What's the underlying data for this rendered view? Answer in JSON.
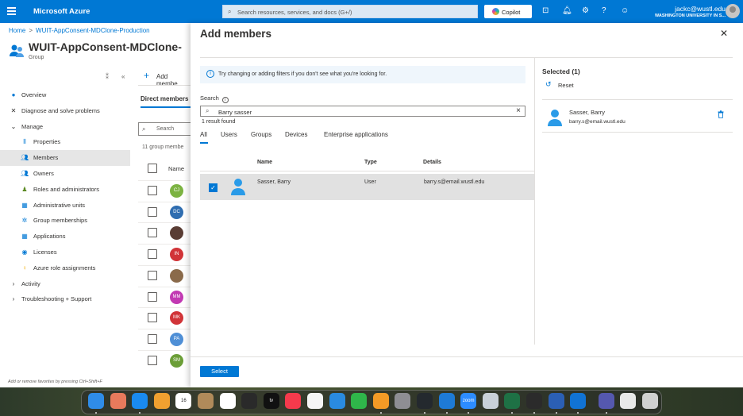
{
  "topbar": {
    "brand": "Microsoft Azure",
    "search_placeholder": "Search resources, services, and docs (G+/)",
    "copilot_label": "Copilot",
    "user_email": "jackc@wustl.edu",
    "user_org": "WASHINGTON UNIVERSITY IN S..."
  },
  "breadcrumb": {
    "home": "Home",
    "current": "WUIT-AppConsent-MDClone-Production"
  },
  "group": {
    "title": "WUIT-AppConsent-MDClone-",
    "subtitle": "Group"
  },
  "nav": [
    {
      "label": "Overview",
      "icon": "info-icon",
      "color": "#0078d4",
      "indent": 0
    },
    {
      "label": "Diagnose and solve problems",
      "icon": "wrench-icon",
      "color": "#323130",
      "indent": 0
    },
    {
      "label": "Manage",
      "icon": "chevron-down-icon",
      "color": "#323130",
      "indent": 0,
      "expander": "⌄"
    },
    {
      "label": "Properties",
      "icon": "properties-icon",
      "color": "#0078d4",
      "indent": 1
    },
    {
      "label": "Members",
      "icon": "members-icon",
      "color": "#0078d4",
      "indent": 1,
      "selected": true
    },
    {
      "label": "Owners",
      "icon": "owners-icon",
      "color": "#0078d4",
      "indent": 1
    },
    {
      "label": "Roles and administrators",
      "icon": "roles-icon",
      "color": "#5c8a24",
      "indent": 1
    },
    {
      "label": "Administrative units",
      "icon": "admin-units-icon",
      "color": "#0078d4",
      "indent": 1
    },
    {
      "label": "Group memberships",
      "icon": "group-memberships-icon",
      "color": "#0078d4",
      "indent": 1
    },
    {
      "label": "Applications",
      "icon": "applications-icon",
      "color": "#0078d4",
      "indent": 1
    },
    {
      "label": "Licenses",
      "icon": "licenses-icon",
      "color": "#0078d4",
      "indent": 1
    },
    {
      "label": "Azure role assignments",
      "icon": "key-icon",
      "color": "#f2b10d",
      "indent": 1
    },
    {
      "label": "Activity",
      "icon": "chevron-right-icon",
      "color": "#323130",
      "indent": 0,
      "expander": "›"
    },
    {
      "label": "Troubleshooting + Support",
      "icon": "chevron-right-icon",
      "color": "#323130",
      "indent": 0,
      "expander": "›"
    }
  ],
  "fav_hint": "Add or remove favorites by pressing Ctrl+Shift+F",
  "middle": {
    "add_label": "Add membe",
    "tab_label": "Direct members",
    "search_label": "Search",
    "count": "11 group membe",
    "name_header": "Name",
    "rows": [
      {
        "initials": "CJ",
        "color": "#7cb342"
      },
      {
        "initials": "DC",
        "color": "#2f6db0"
      },
      {
        "initials": "",
        "color": "#5a3d34"
      },
      {
        "initials": "IN",
        "color": "#d13438"
      },
      {
        "initials": "",
        "color": "#8a6a4a"
      },
      {
        "initials": "MM",
        "color": "#c239b3"
      },
      {
        "initials": "MK",
        "color": "#d13438"
      },
      {
        "initials": "PA",
        "color": "#4f8fd6"
      },
      {
        "initials": "SM",
        "color": "#6b9e37"
      }
    ]
  },
  "panel": {
    "title": "Add members",
    "info": "Try changing or adding filters if you don't see what you're looking for.",
    "search_label": "Search",
    "search_value": "Barry sasser",
    "result_count": "1 result found",
    "tabs": [
      "All",
      "Users",
      "Groups",
      "Devices",
      "Enterprise applications"
    ],
    "headers": {
      "name": "Name",
      "type": "Type",
      "details": "Details"
    },
    "results": [
      {
        "name": "Sasser, Barry",
        "type": "User",
        "details": "barry.s@email.wustl.edu"
      }
    ],
    "selected_header": "Selected (1)",
    "reset_label": "Reset",
    "selected": [
      {
        "name": "Sasser, Barry",
        "email": "barry.s@email.wustl.edu"
      }
    ],
    "select_button": "Select"
  },
  "dock": {
    "calendar_day": "16",
    "apps": [
      {
        "name": "finder-icon",
        "color": "#2f8ce8"
      },
      {
        "name": "launchpad-icon",
        "color": "#e87a5c"
      },
      {
        "name": "safari-icon",
        "color": "#1a8af0"
      },
      {
        "name": "photos-icon",
        "color": "#f0a030"
      },
      {
        "name": "calendar-icon",
        "color": "#ffffff"
      },
      {
        "name": "contacts-icon",
        "color": "#b08a5a"
      },
      {
        "name": "reminders-icon",
        "color": "#ffffff"
      },
      {
        "name": "music-app-icon",
        "color": "#2a2a2a"
      },
      {
        "name": "appletv-icon",
        "color": "#111111"
      },
      {
        "name": "music-icon",
        "color": "#f53a4c"
      },
      {
        "name": "news-icon",
        "color": "#f5f5f5"
      },
      {
        "name": "keynote-icon",
        "color": "#2a8ae0"
      },
      {
        "name": "numbers-icon",
        "color": "#2fb64a"
      },
      {
        "name": "pages-icon",
        "color": "#f39a26"
      },
      {
        "name": "settings-icon",
        "color": "#8e8e93"
      },
      {
        "name": "github-icon",
        "color": "#24292e"
      },
      {
        "name": "vscode-icon",
        "color": "#1e7ad6"
      },
      {
        "name": "zoom-icon",
        "color": "#2d8cff"
      },
      {
        "name": "filezilla-icon",
        "color": "#c8d0d8"
      },
      {
        "name": "excel-icon",
        "color": "#1e7145"
      },
      {
        "name": "terminal-icon",
        "color": "#2b2b2b"
      },
      {
        "name": "word-icon",
        "color": "#2b5fb4"
      },
      {
        "name": "outlook-icon",
        "color": "#1173d4"
      },
      {
        "name": "teams-icon",
        "color": "#5558af"
      },
      {
        "name": "document-icon",
        "color": "#e8e8e8"
      },
      {
        "name": "trash-icon",
        "color": "#d0d0d0"
      }
    ],
    "zoom_label": "zoom",
    "tv_label": "tv"
  }
}
